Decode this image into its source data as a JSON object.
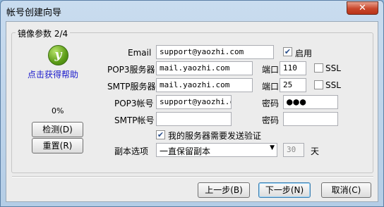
{
  "window": {
    "title": "帐号创建向导",
    "close_glyph": "✕"
  },
  "group": {
    "title": "镜像参数 2/4"
  },
  "sidebar": {
    "help_link": "点击获得帮助",
    "progress": "0%",
    "check_button": "检测(D)",
    "reset_button": "重置(R)"
  },
  "form": {
    "email_label": "Email",
    "email_value": "support@yaozhi.com",
    "enable_label": "启用",
    "enable_checked": true,
    "pop3_server_label": "POP3服务器",
    "pop3_server_value": "mail.yaozhi.com",
    "pop3_port_label": "端口",
    "pop3_port_value": "110",
    "pop3_ssl_label": "SSL",
    "smtp_server_label": "SMTP服务器",
    "smtp_server_value": "mail.yaozhi.com",
    "smtp_port_label": "端口",
    "smtp_port_value": "25",
    "smtp_ssl_label": "SSL",
    "pop3_account_label": "POP3帐号",
    "pop3_account_value": "support@yaozhi.co",
    "pop3_password_label": "密码",
    "pop3_password_value": "●●●",
    "smtp_account_label": "SMTP帐号",
    "smtp_account_value": "",
    "smtp_password_label": "密码",
    "smtp_password_value": "",
    "smtp_auth_label": "我的服务器需要发送验证",
    "smtp_auth_checked": true,
    "copy_option_label": "副本选项",
    "copy_option_value": "一直保留副本",
    "days_value": "30",
    "days_unit": "天"
  },
  "footer": {
    "prev_button": "上一步(B)",
    "next_button": "下一步(N)",
    "cancel_button": "取消(C)"
  },
  "colors": {
    "accent": "#3c7fb1",
    "link": "#1a1acc",
    "close": "#c9472b"
  }
}
